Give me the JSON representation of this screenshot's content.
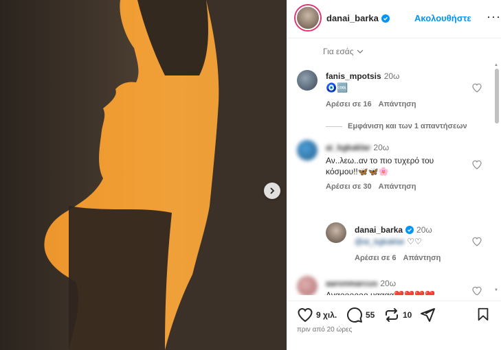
{
  "header": {
    "username": "danai_barka",
    "follow_label": "Ακολουθήστε",
    "more_label": "···"
  },
  "filter": {
    "label": "Για εσάς"
  },
  "comments": [
    {
      "username": "fanis_mpotsis",
      "time": "20ω",
      "text": "🧿🆒",
      "likes": "Αρέσει σε 16",
      "reply_label": "Απάντηση",
      "view_replies": "Εμφάνιση και των 1 απαντήσεων"
    },
    {
      "username": "ai_kgkaklar",
      "time": "20ω",
      "text_line1": "Αν..λεω..αν το πιο τυχερό του",
      "text_line2": "κόσμου!!🦋🦋🌸",
      "likes": "Αρέσει σε 30",
      "reply_label": "Απάντηση"
    },
    {
      "username": "danai_barka",
      "time": "20ω",
      "mention": "@ai_kgkaklar",
      "text": "♡♡",
      "likes": "Αρέσει σε 6",
      "reply_label": "Απάντηση"
    },
    {
      "username": "aaronmarcus",
      "time": "20ω",
      "text": "Αγαρρρρρρ υαααα❤️❤️❤️❤️"
    }
  ],
  "actions": {
    "likes": "9 χιλ.",
    "comments": "55",
    "reposts": "10"
  },
  "timestamp": "πριν από 20 ώρες",
  "colors": {
    "accent": "#0095f6",
    "text": "#262626",
    "muted": "#737373",
    "photo_orange": "#ef9a30"
  }
}
